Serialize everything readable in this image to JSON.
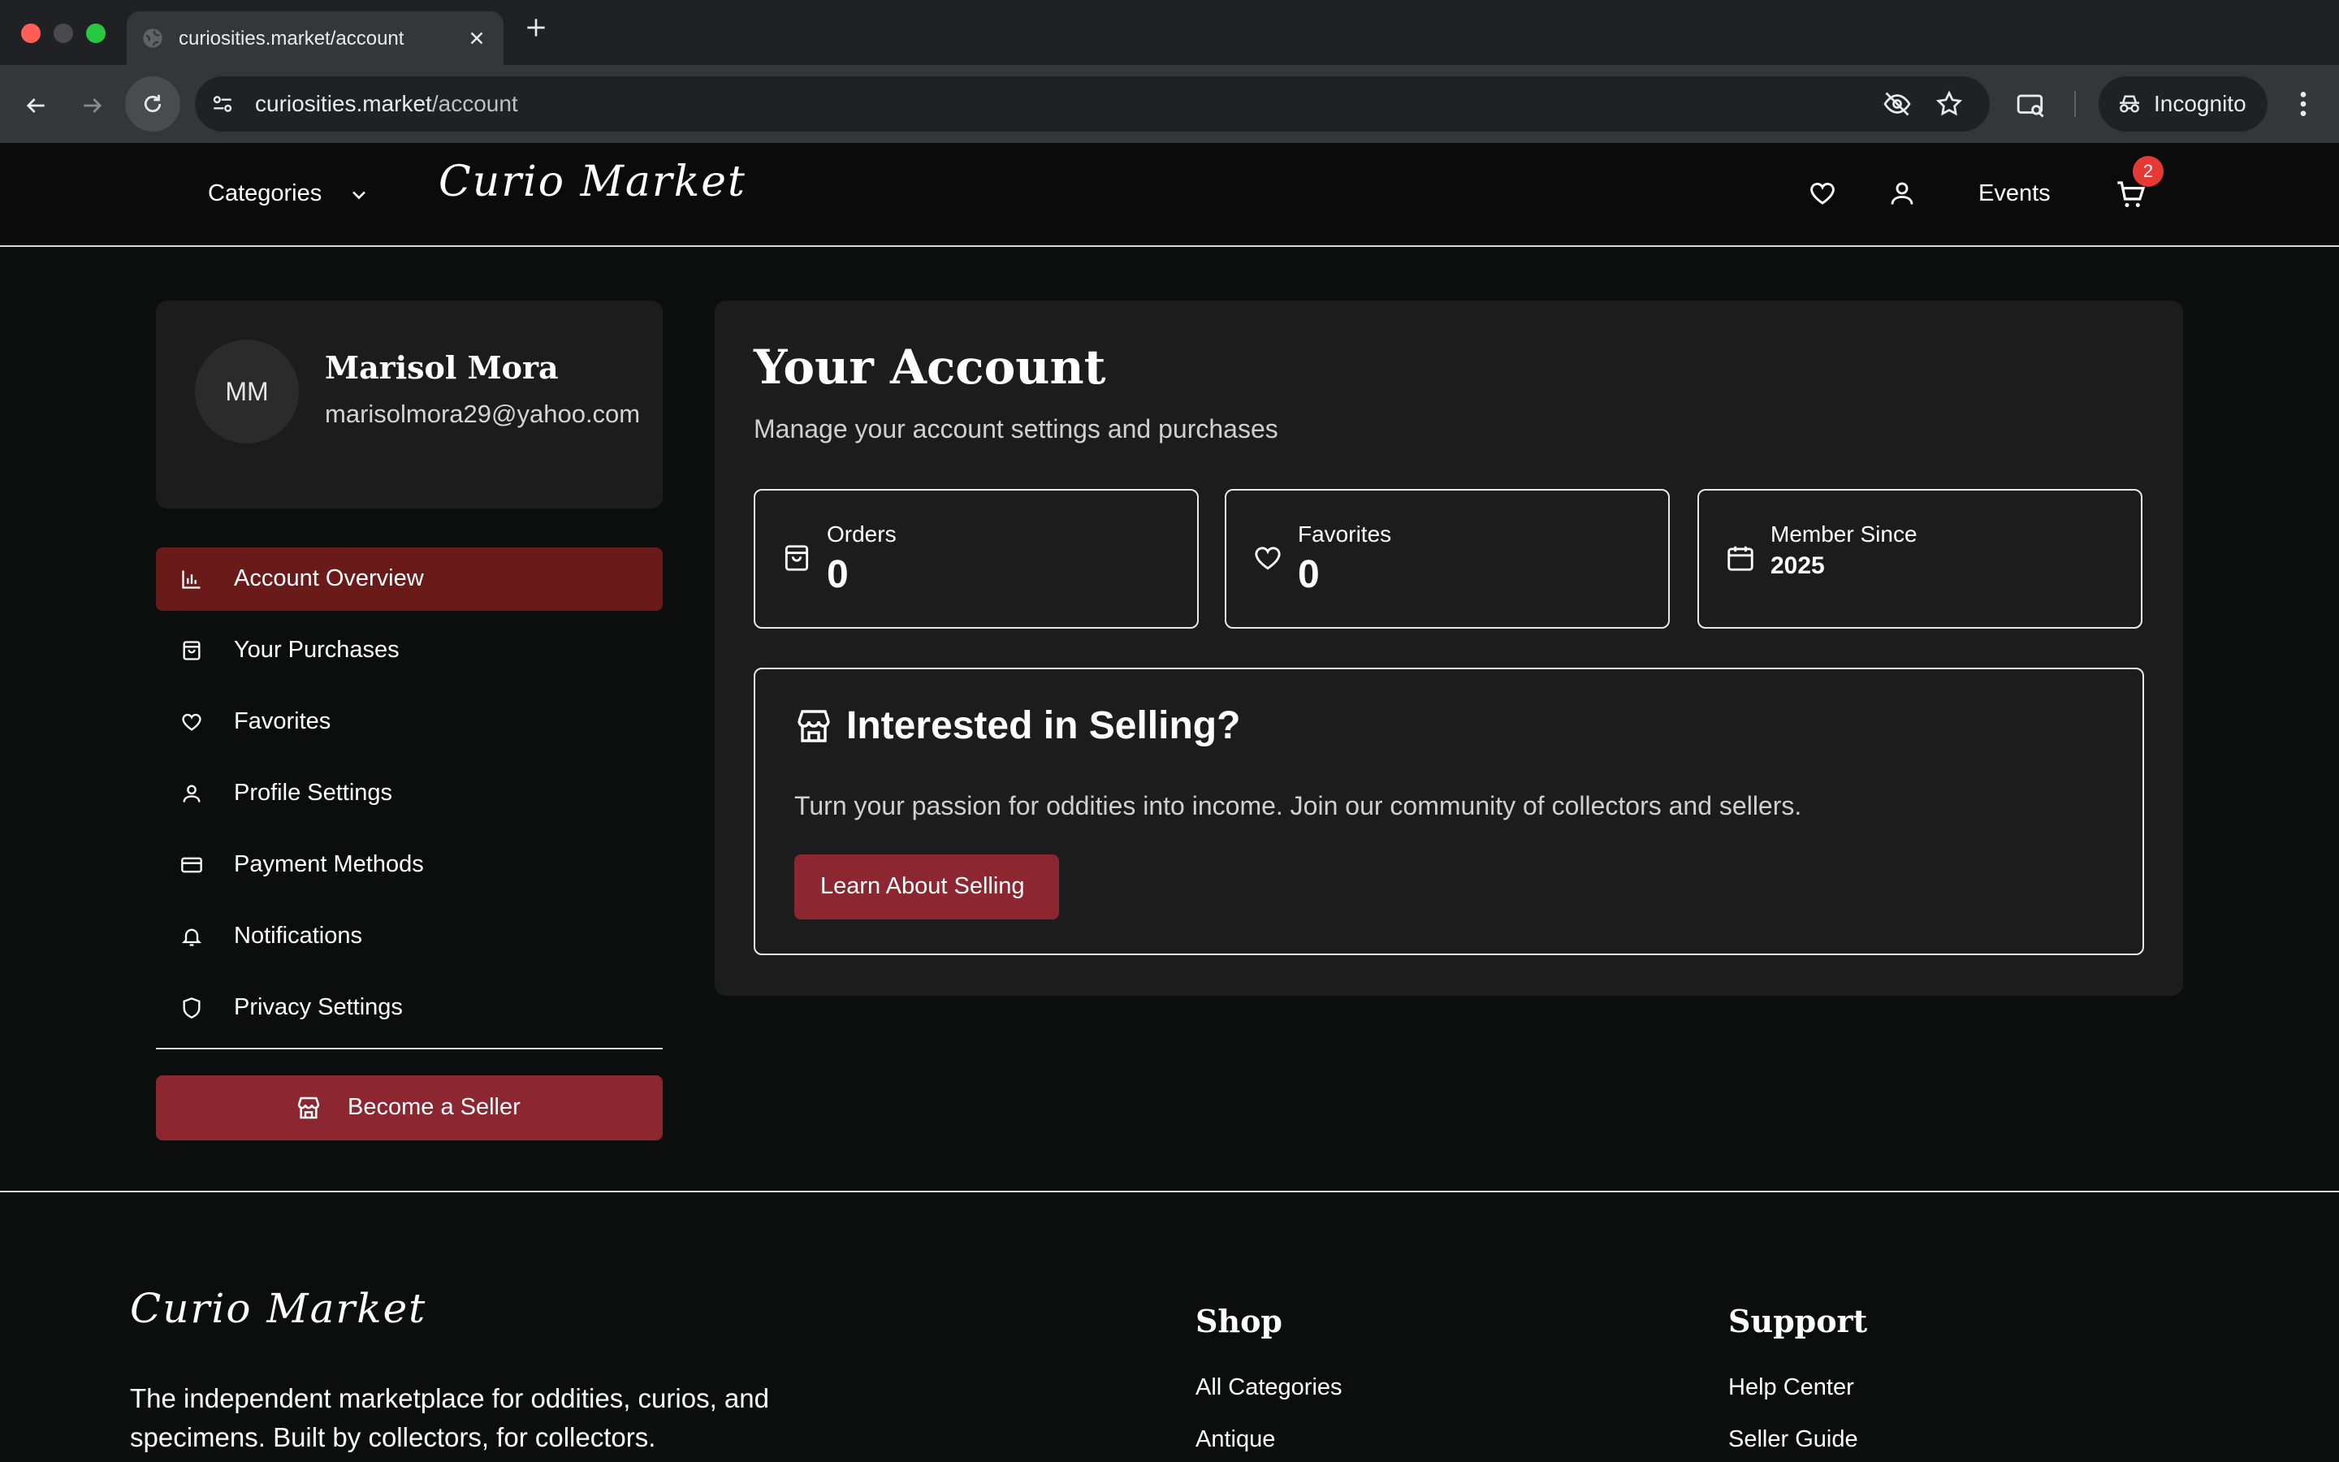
{
  "browser": {
    "tab_title": "curiosities.market/account",
    "url_host": "curiosities.market",
    "url_path": "/account",
    "incognito_label": "Incognito",
    "new_tab": "+"
  },
  "header": {
    "categories_label": "Categories",
    "logo_first": "Curio",
    "logo_second": "Market",
    "events_label": "Events",
    "cart_count": "2"
  },
  "profile": {
    "initials": "MM",
    "name": "Marisol Mora",
    "email": "marisolmora29@yahoo.com"
  },
  "sidebar": {
    "items": [
      {
        "label": "Account Overview",
        "icon": "bar-chart-icon",
        "active": true
      },
      {
        "label": "Your Purchases",
        "icon": "shopping-bag-icon"
      },
      {
        "label": "Favorites",
        "icon": "heart-icon"
      },
      {
        "label": "Profile Settings",
        "icon": "user-icon"
      },
      {
        "label": "Payment Methods",
        "icon": "credit-card-icon"
      },
      {
        "label": "Notifications",
        "icon": "bell-icon"
      },
      {
        "label": "Privacy Settings",
        "icon": "shield-icon"
      }
    ],
    "become_seller": "Become a Seller"
  },
  "main": {
    "title": "Your Account",
    "subtitle": "Manage your account settings and purchases",
    "stats": [
      {
        "label": "Orders",
        "value": "0",
        "icon": "shopping-bag-icon"
      },
      {
        "label": "Favorites",
        "value": "0",
        "icon": "heart-icon"
      },
      {
        "label": "Member Since",
        "value": "2025",
        "icon": "calendar-icon"
      }
    ],
    "sell": {
      "title": "Interested in Selling?",
      "text": "Turn your passion for oddities into income. Join our community of collectors and sellers.",
      "button": "Learn About Selling"
    }
  },
  "footer": {
    "description": "The independent marketplace for oddities, curios, and specimens. Built by collectors, for collectors.",
    "shop_heading": "Shop",
    "shop_links": [
      "All Categories",
      "Antique"
    ],
    "support_heading": "Support",
    "support_links": [
      "Help Center",
      "Seller Guide"
    ]
  },
  "colors": {
    "accent": "#8c2631",
    "active_nav": "#6b1a1a",
    "badge": "#e53935",
    "panel": "#1c1c1c",
    "background": "#0c0d0d"
  }
}
